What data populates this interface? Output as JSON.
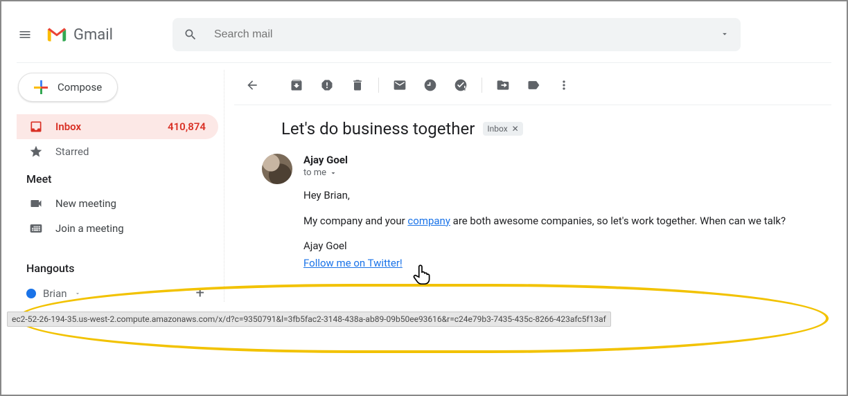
{
  "header": {
    "app_name": "Gmail",
    "search_placeholder": "Search mail"
  },
  "sidebar": {
    "compose_label": "Compose",
    "items": [
      {
        "label": "Inbox",
        "count": "410,874"
      },
      {
        "label": "Starred"
      }
    ],
    "meet": {
      "title": "Meet",
      "new_meeting": "New meeting",
      "join_meeting": "Join a meeting"
    },
    "hangouts": {
      "title": "Hangouts",
      "user_name": "Brian"
    }
  },
  "message": {
    "subject": "Let's do business together",
    "label_chip": "Inbox",
    "sender_name": "Ajay Goel",
    "to_line": "to me",
    "greeting": "Hey Brian,",
    "line2_pre": "My company and your ",
    "line2_link": "company",
    "line2_post": " are both awesome companies, so let's work together. When can we talk?",
    "signature_name": "Ajay Goel",
    "signature_link": "Follow me on Twitter!"
  },
  "status_bar": {
    "text": "ec2-52-26-194-35.us-west-2.compute.amazonaws.com/x/d?c=9350791&l=3fb5fac2-3148-438a-ab89-09b50ee93616&r=c24e79b3-7435-435c-8266-423afc5f13af"
  }
}
